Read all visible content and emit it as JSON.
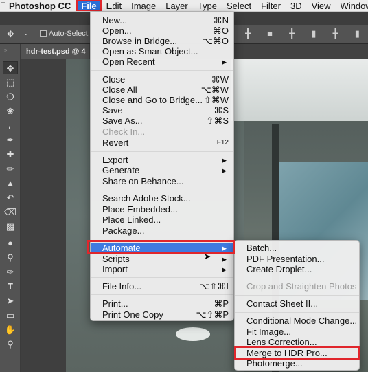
{
  "menubar": {
    "apple_icon": "apple-logo-icon",
    "app_name": "Photoshop CC",
    "items": [
      "File",
      "Edit",
      "Image",
      "Layer",
      "Type",
      "Select",
      "Filter",
      "3D",
      "View",
      "Window"
    ]
  },
  "options_bar": {
    "move_icon": "move-tool-icon",
    "auto_select_label": "Auto-Select:"
  },
  "document": {
    "tab_title": "hdr-test.psd @ 4"
  },
  "toolbar": {
    "tools": [
      "move",
      "marquee",
      "lasso",
      "quick-selection",
      "crop",
      "eyedropper",
      "healing-brush",
      "brush",
      "clone-stamp",
      "history-brush",
      "eraser",
      "gradient",
      "blur",
      "dodge",
      "pen",
      "type",
      "path-selection",
      "rectangle",
      "hand",
      "zoom"
    ]
  },
  "file_menu": {
    "items": [
      {
        "label": "New...",
        "shortcut": "⌘N"
      },
      {
        "label": "Open...",
        "shortcut": "⌘O"
      },
      {
        "label": "Browse in Bridge...",
        "shortcut": "⌥⌘O"
      },
      {
        "label": "Open as Smart Object...",
        "shortcut": ""
      },
      {
        "label": "Open Recent",
        "shortcut": "▶"
      },
      {
        "label": "Close",
        "shortcut": "⌘W"
      },
      {
        "label": "Close All",
        "shortcut": "⌥⌘W"
      },
      {
        "label": "Close and Go to Bridge...",
        "shortcut": "⇧⌘W"
      },
      {
        "label": "Save",
        "shortcut": "⌘S"
      },
      {
        "label": "Save As...",
        "shortcut": "⇧⌘S"
      },
      {
        "label": "Check In...",
        "shortcut": ""
      },
      {
        "label": "Revert",
        "shortcut": "F12"
      },
      {
        "label": "Export",
        "shortcut": "▶"
      },
      {
        "label": "Generate",
        "shortcut": "▶"
      },
      {
        "label": "Share on Behance...",
        "shortcut": ""
      },
      {
        "label": "Search Adobe Stock...",
        "shortcut": ""
      },
      {
        "label": "Place Embedded...",
        "shortcut": ""
      },
      {
        "label": "Place Linked...",
        "shortcut": ""
      },
      {
        "label": "Package...",
        "shortcut": ""
      },
      {
        "label": "Automate",
        "shortcut": "▶"
      },
      {
        "label": "Scripts",
        "shortcut": "▶"
      },
      {
        "label": "Import",
        "shortcut": "▶"
      },
      {
        "label": "File Info...",
        "shortcut": "⌥⇧⌘I"
      },
      {
        "label": "Print...",
        "shortcut": "⌘P"
      },
      {
        "label": "Print One Copy",
        "shortcut": "⌥⇧⌘P"
      }
    ]
  },
  "automate_menu": {
    "items": [
      "Batch...",
      "PDF Presentation...",
      "Create Droplet...",
      "Crop and Straighten Photos",
      "Contact Sheet II...",
      "Conditional Mode Change...",
      "Fit Image...",
      "Lens Correction...",
      "Merge to HDR Pro...",
      "Photomerge..."
    ]
  },
  "colors": {
    "highlight": "#3f7ae0",
    "annotation_red": "#e0262c",
    "menubar_bg": "#ececec",
    "panel_bg": "#535353"
  }
}
